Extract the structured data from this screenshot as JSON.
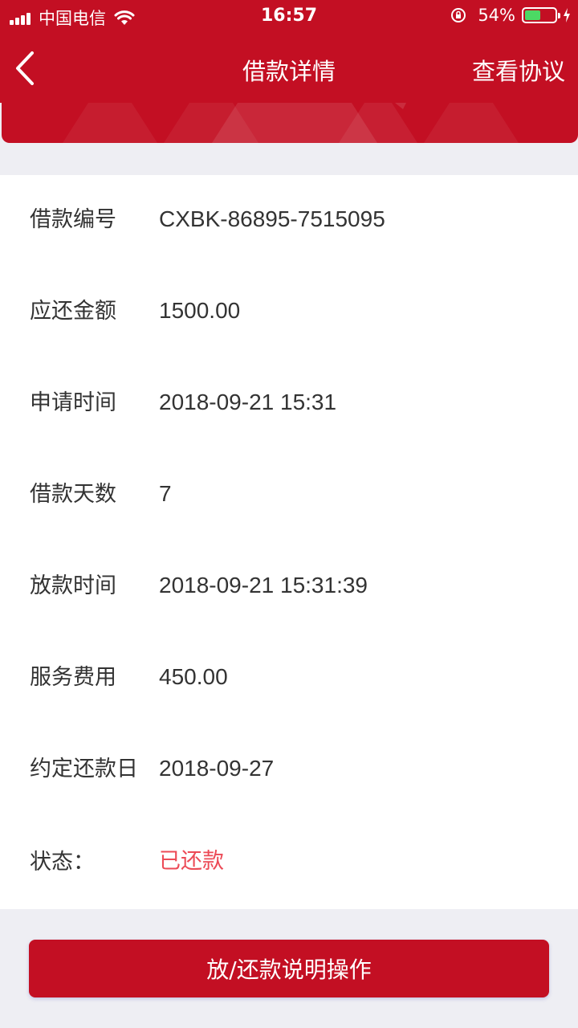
{
  "status_bar": {
    "carrier": "中国电信",
    "time": "16:57",
    "battery": "54%",
    "battery_level": 0.54,
    "battery_color": "#4cd964"
  },
  "nav": {
    "back_icon": "chevron-left-icon",
    "title": "借款详情",
    "right_action": "查看协议"
  },
  "colors": {
    "brand_red": "#c30f23",
    "status_red": "#ec4a56",
    "background": "#eeeef3"
  },
  "details": [
    {
      "label": "借款编号",
      "value": "CXBK-86895-7515095"
    },
    {
      "label": "应还金额",
      "value": "1500.00"
    },
    {
      "label": "申请时间",
      "value": "2018-09-21 15:31"
    },
    {
      "label": "借款天数",
      "value": "7"
    },
    {
      "label": "放款时间",
      "value": "2018-09-21 15:31:39"
    },
    {
      "label": "服务费用",
      "value": "450.00"
    },
    {
      "label": "约定还款日",
      "value": "2018-09-27"
    },
    {
      "label": "状态：",
      "value": "已还款"
    }
  ],
  "footer": {
    "button_label": "放/还款说明操作"
  }
}
